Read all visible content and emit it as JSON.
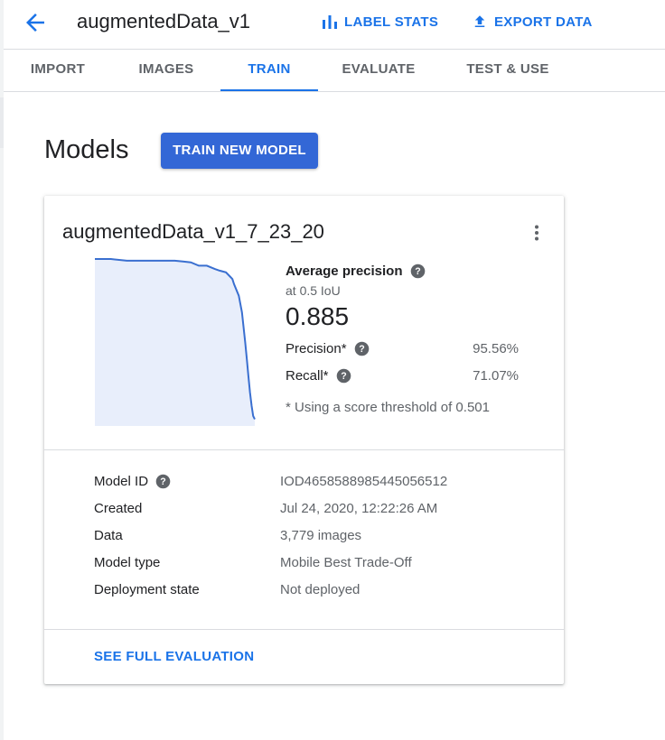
{
  "header": {
    "title": "augmentedData_v1",
    "back_icon": "arrow-back-icon",
    "actions": [
      {
        "label": "LABEL STATS",
        "icon": "bar-chart-icon"
      },
      {
        "label": "EXPORT DATA",
        "icon": "upload-icon"
      }
    ]
  },
  "tabs": [
    {
      "label": "IMPORT",
      "active": false
    },
    {
      "label": "IMAGES",
      "active": false
    },
    {
      "label": "TRAIN",
      "active": true
    },
    {
      "label": "EVALUATE",
      "active": false
    },
    {
      "label": "TEST & USE",
      "active": false
    }
  ],
  "models": {
    "title": "Models",
    "train_button": "TRAIN NEW MODEL"
  },
  "card": {
    "model_name": "augmentedData_v1_7_23_20",
    "menu_icon": "more-vert-icon",
    "metrics": {
      "avg_precision_label": "Average precision",
      "iou_label": "at 0.5 IoU",
      "avg_precision_value": "0.885",
      "precision_label": "Precision*",
      "precision_value": "95.56%",
      "recall_label": "Recall*",
      "recall_value": "71.07%",
      "threshold_note": "* Using a score threshold of 0.501"
    },
    "details": [
      {
        "key": "Model ID",
        "value": "IOD4658588985445056512",
        "help": true
      },
      {
        "key": "Created",
        "value": "Jul 24, 2020, 12:22:26 AM",
        "help": false
      },
      {
        "key": "Data",
        "value": "3,779 images",
        "help": false
      },
      {
        "key": "Model type",
        "value": "Mobile Best Trade-Off",
        "help": false
      },
      {
        "key": "Deployment state",
        "value": "Not deployed",
        "help": false
      }
    ],
    "see_full_evaluation": "SEE FULL EVALUATION"
  },
  "colors": {
    "accent": "#1a73e8",
    "button": "#3367d6",
    "curve": "#3a6fd0",
    "curve_fill": "#e8eefb"
  },
  "chart_data": {
    "type": "area",
    "xlabel": "",
    "ylabel": "",
    "xlim": [
      0,
      1
    ],
    "ylim": [
      0,
      1
    ],
    "grid": false,
    "series": [
      {
        "x": [
          0.0,
          0.05,
          0.1,
          0.2,
          0.3,
          0.4,
          0.5,
          0.55,
          0.6,
          0.65,
          0.7,
          0.75,
          0.78,
          0.82,
          0.84,
          0.86,
          0.87,
          0.9,
          0.92,
          0.94,
          0.95,
          0.96,
          0.97,
          0.98,
          0.99,
          1.0
        ],
        "y": [
          1.0,
          1.0,
          1.0,
          0.99,
          0.99,
          0.99,
          0.99,
          0.985,
          0.98,
          0.96,
          0.96,
          0.94,
          0.93,
          0.92,
          0.9,
          0.88,
          0.85,
          0.78,
          0.68,
          0.5,
          0.4,
          0.3,
          0.2,
          0.12,
          0.06,
          0.04
        ]
      }
    ]
  }
}
